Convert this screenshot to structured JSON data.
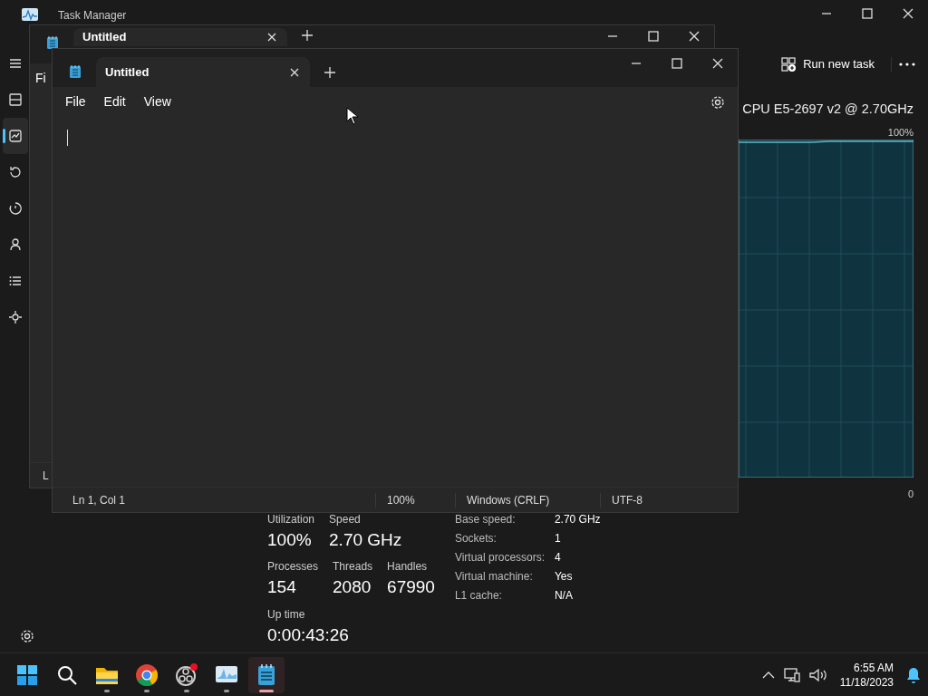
{
  "task_manager": {
    "title": "Task Manager",
    "sidebar": [
      {
        "kind": "menu",
        "selected": false
      },
      {
        "kind": "processes",
        "selected": false
      },
      {
        "kind": "performance",
        "selected": true
      },
      {
        "kind": "history",
        "selected": false
      },
      {
        "kind": "startup",
        "selected": false
      },
      {
        "kind": "users",
        "selected": false
      },
      {
        "kind": "details",
        "selected": false
      },
      {
        "kind": "services",
        "selected": false
      }
    ],
    "run_new_task": "Run new task",
    "cpu_name": "CPU E5-2697 v2 @ 2.70GHz",
    "graph_max": "100%",
    "graph_min": "0",
    "stats": [
      [
        {
          "label": "Utilization",
          "value": "100%"
        },
        {
          "label": "Speed",
          "value": "2.70 GHz"
        }
      ],
      [
        {
          "label": "Processes",
          "value": "154"
        },
        {
          "label": "Threads",
          "value": "2080"
        },
        {
          "label": "Handles",
          "value": "67990"
        }
      ],
      [
        {
          "label": "Up time",
          "value": "0:00:43:26"
        }
      ]
    ],
    "specs": [
      {
        "label": "Base speed:",
        "value": "2.70 GHz"
      },
      {
        "label": "Sockets:",
        "value": "1"
      },
      {
        "label": "Virtual processors:",
        "value": "4"
      },
      {
        "label": "Virtual machine:",
        "value": "Yes"
      },
      {
        "label": "L1 cache:",
        "value": "N/A"
      }
    ]
  },
  "back_notepad": {
    "tab_title": "Untitled",
    "menu_fragment": "Fi",
    "status_fragment": "L"
  },
  "notepad": {
    "tab_title": "Untitled",
    "menu": [
      "File",
      "Edit",
      "View"
    ],
    "status": [
      "Ln 1, Col 1",
      "100%",
      "Windows (CRLF)",
      "UTF-8"
    ]
  },
  "taskbar": {
    "apps": [
      {
        "kind": "start",
        "running": false,
        "selected": false
      },
      {
        "kind": "search",
        "running": false,
        "selected": false
      },
      {
        "kind": "folder",
        "running": true,
        "selected": false
      },
      {
        "kind": "browser",
        "running": true,
        "selected": false
      },
      {
        "kind": "recorder",
        "running": true,
        "selected": false
      },
      {
        "kind": "monitor",
        "running": true,
        "selected": false
      },
      {
        "kind": "notepad",
        "running": true,
        "selected": true
      }
    ],
    "time": "6:55 AM",
    "date": "11/18/2023"
  }
}
